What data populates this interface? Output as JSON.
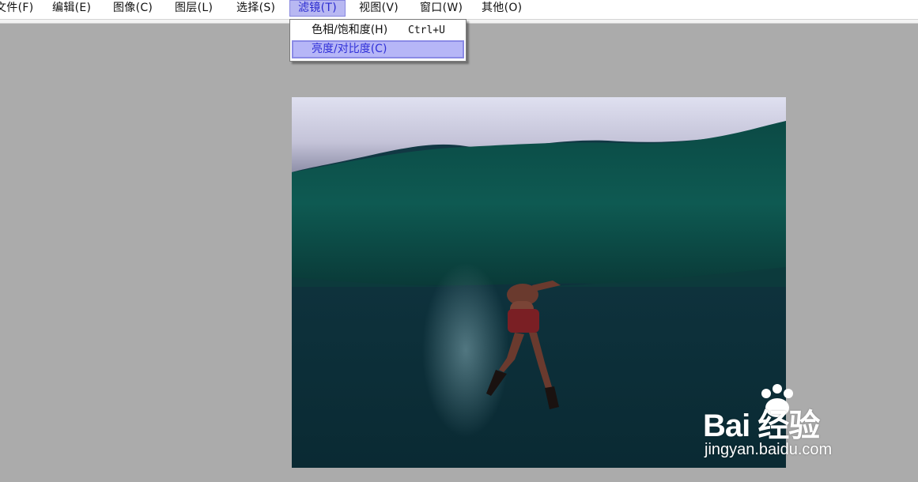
{
  "menubar": {
    "items": [
      {
        "label": "文件(F)",
        "active": false
      },
      {
        "label": "编辑(E)",
        "active": false
      },
      {
        "label": "图像(C)",
        "active": false
      },
      {
        "label": "图层(L)",
        "active": false
      },
      {
        "label": "选择(S)",
        "active": false
      },
      {
        "label": "滤镜(T)",
        "active": true
      },
      {
        "label": "视图(V)",
        "active": false
      },
      {
        "label": "窗口(W)",
        "active": false
      },
      {
        "label": "其他(O)",
        "active": false
      }
    ]
  },
  "filter_menu": {
    "items": [
      {
        "label": "色相/饱和度(H)",
        "shortcut": "Ctrl+U",
        "highlighted": false
      },
      {
        "label": "亮度/对比度(C)",
        "shortcut": "",
        "highlighted": true
      }
    ]
  },
  "watermark": {
    "brand_text": "Bai 经验",
    "url": "jingyan.baidu.com"
  },
  "colors": {
    "workspace_bg": "#ababab",
    "menu_highlight": "#b6b6f7",
    "menu_highlight_text": "#3030d8"
  }
}
